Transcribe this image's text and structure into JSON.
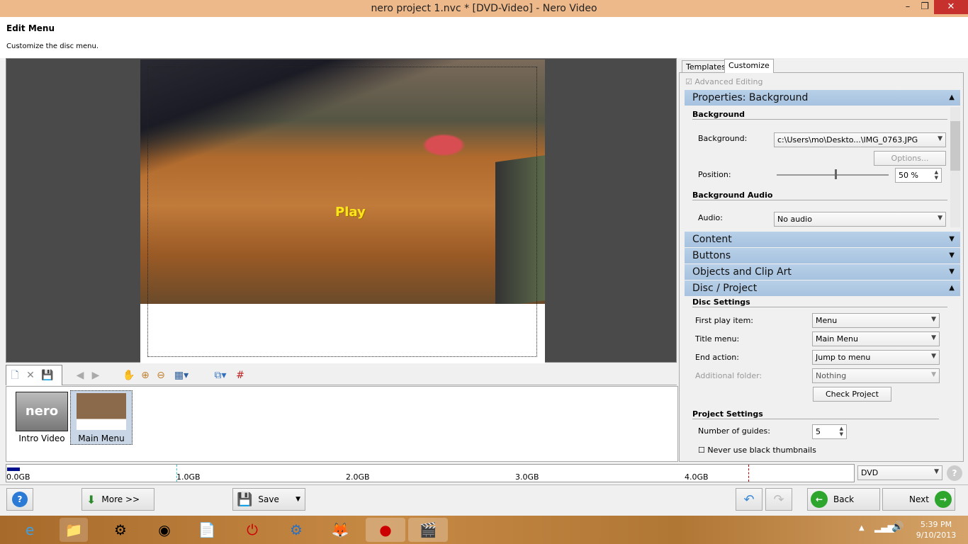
{
  "window": {
    "title": "nero project 1.nvc * [DVD-Video] - Nero Video",
    "min": "–",
    "max": "❐",
    "close": "✕"
  },
  "header": {
    "title": "Edit Menu",
    "subtitle": "Customize the disc menu."
  },
  "preview": {
    "button_text": "Play"
  },
  "thumbs": [
    {
      "label": "Intro Video",
      "logo": "nero"
    },
    {
      "label": "Main Menu"
    }
  ],
  "capacity": {
    "labels": [
      "0.0GB",
      "1.0GB",
      "2.0GB",
      "3.0GB",
      "4.0GB"
    ],
    "used_fraction": 0.004,
    "limit_gb": 4.38,
    "disc_type": "DVD"
  },
  "panel": {
    "tabs": [
      "Templates",
      "Customize"
    ],
    "advanced_editing": "Advanced Editing",
    "properties": {
      "title": "Properties: Background",
      "background_heading": "Background",
      "background_label": "Background:",
      "background_value": "c:\\Users\\mo\\Deskto...\\IMG_0763.JPG",
      "options": "Options...",
      "position_label": "Position:",
      "position_value": "50 %",
      "position_percent": 50,
      "audio_heading": "Background Audio",
      "audio_label": "Audio:",
      "audio_value": "No audio"
    },
    "sections": [
      "Content",
      "Buttons",
      "Objects and Clip Art"
    ],
    "disc": {
      "title": "Disc / Project",
      "disc_settings": "Disc Settings",
      "first_play_label": "First play item:",
      "first_play_value": "Menu",
      "title_menu_label": "Title menu:",
      "title_menu_value": "Main Menu",
      "end_action_label": "End action:",
      "end_action_value": "Jump to menu",
      "additional_label": "Additional folder:",
      "additional_value": "Nothing",
      "check": "Check Project",
      "project_settings": "Project Settings",
      "guides_label": "Number of guides:",
      "guides_value": "5",
      "black_thumbs": "Never use black thumbnails"
    }
  },
  "bottom": {
    "more": "More >>",
    "save": "Save",
    "back": "Back",
    "next": "Next"
  },
  "taskbar": {
    "time": "5:39 PM",
    "date": "9/10/2013"
  }
}
